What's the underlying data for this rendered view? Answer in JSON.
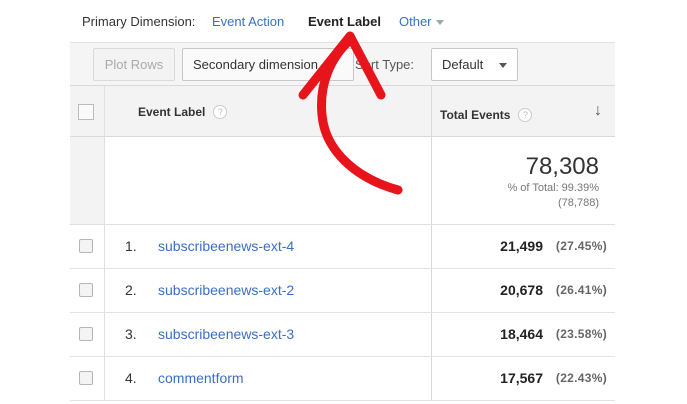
{
  "primary_dimension": {
    "label": "Primary Dimension:",
    "options": [
      "Event Action",
      "Event Label",
      "Other"
    ],
    "active": "Event Label"
  },
  "toolbar": {
    "plot_rows": "Plot Rows",
    "secondary_dimension": "Secondary dimension",
    "sort_type_label": "Sort Type:",
    "sort_type_value": "Default"
  },
  "table": {
    "header": {
      "label_col": "Event Label",
      "total_col": "Total Events",
      "help": "?"
    },
    "summary": {
      "total": "78,308",
      "pct_of_total": "% of Total: 99.39%",
      "abs_total": "(78,788)"
    },
    "rows": [
      {
        "num": "1.",
        "label": "subscribeenews-ext-4",
        "value": "21,499",
        "pct": "(27.45%)"
      },
      {
        "num": "2.",
        "label": "subscribeenews-ext-2",
        "value": "20,678",
        "pct": "(26.41%)"
      },
      {
        "num": "3.",
        "label": "subscribeenews-ext-3",
        "value": "18,464",
        "pct": "(23.58%)"
      },
      {
        "num": "4.",
        "label": "commentform",
        "value": "17,567",
        "pct": "(22.43%)"
      }
    ]
  },
  "colors": {
    "link": "#3a6fc4",
    "annotation_arrow": "#e8141b"
  }
}
